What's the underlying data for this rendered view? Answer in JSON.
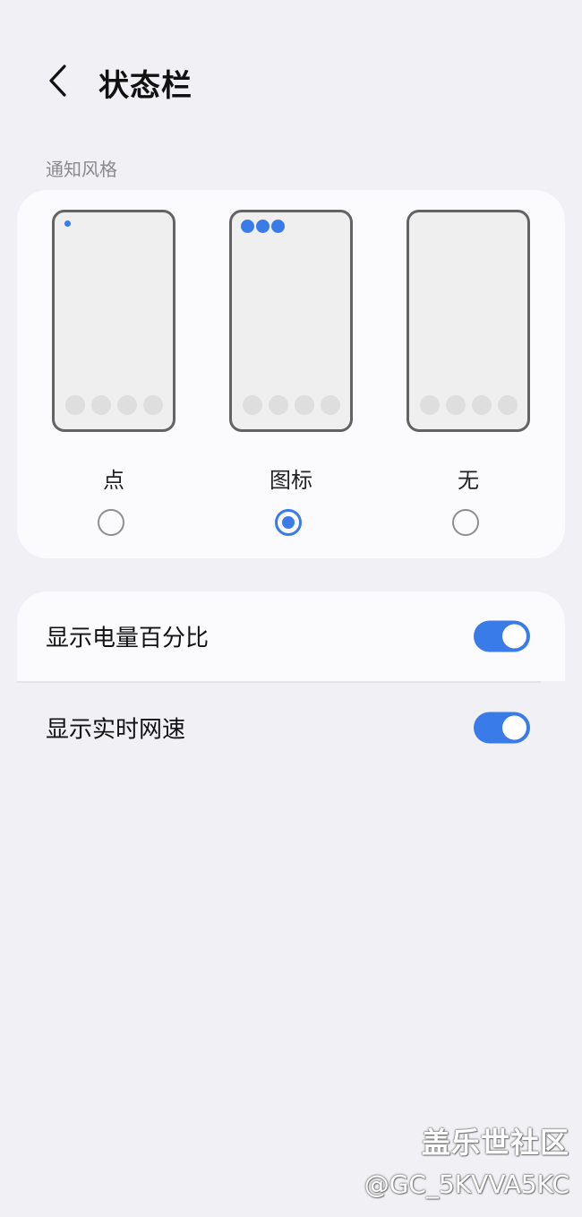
{
  "header": {
    "title": "状态栏"
  },
  "notification_style": {
    "section_label": "通知风格",
    "options": [
      {
        "label": "点",
        "selected": false
      },
      {
        "label": "图标",
        "selected": true
      },
      {
        "label": "无",
        "selected": false
      }
    ]
  },
  "settings": [
    {
      "label": "显示电量百分比",
      "enabled": true
    },
    {
      "label": "显示实时网速",
      "enabled": true
    }
  ],
  "watermark": {
    "line1": "盖乐世社区",
    "line2": "@GC_5KVVA5KC"
  },
  "colors": {
    "accent": "#3a7bea",
    "background": "#f1f1f5",
    "card": "#fbfbfd"
  }
}
